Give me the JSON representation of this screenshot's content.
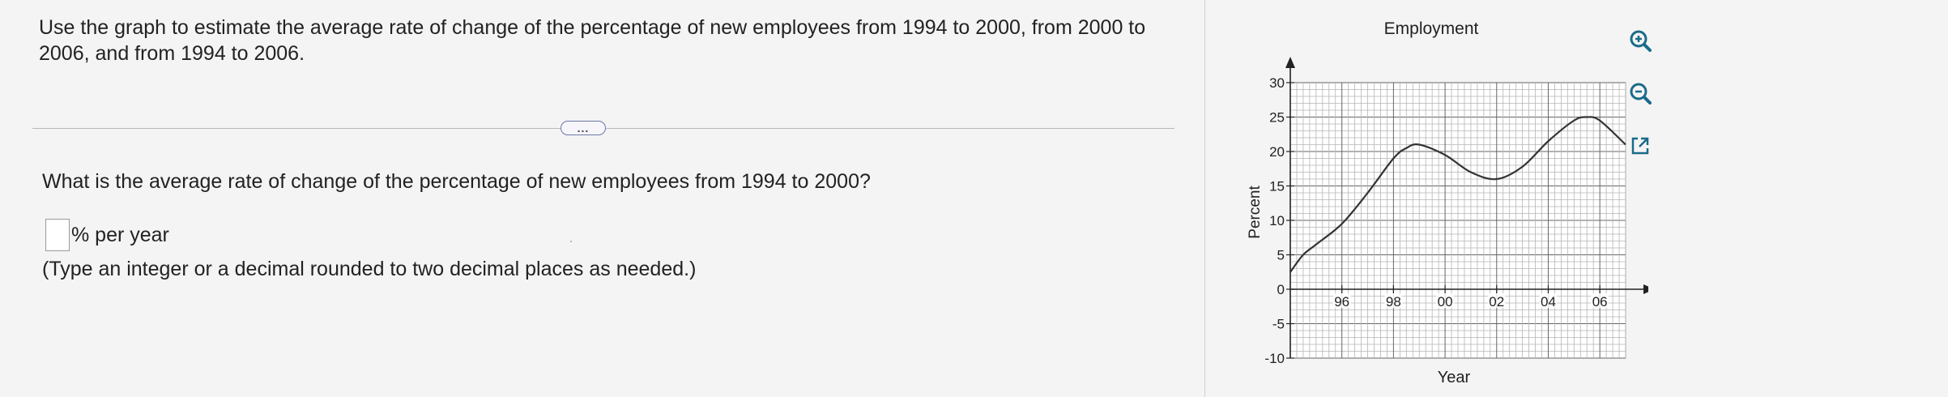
{
  "problem": {
    "prompt": "Use the graph to estimate the average rate of change of the percentage of new employees from 1994 to 2000, from 2000 to 2006, and from 1994 to 2006.",
    "more_label": "...",
    "question": "What is the average rate of change of the percentage of new employees from 1994 to 2000?",
    "answer": {
      "value": "",
      "unit": "% per year"
    },
    "hint": "(Type an integer or a decimal rounded to two decimal places as needed.)"
  },
  "graph": {
    "title": "Employment",
    "xlabel": "Year",
    "ylabel": "Percent",
    "y_ticks": [
      "30",
      "25",
      "20",
      "15",
      "10",
      "5",
      "0",
      "-5",
      "-10"
    ],
    "x_ticks": [
      "96",
      "98",
      "00",
      "02",
      "04",
      "06"
    ]
  },
  "chart_data": {
    "type": "line",
    "title": "Employment",
    "xlabel": "Year",
    "ylabel": "Percent",
    "xlim": [
      1994,
      2007
    ],
    "ylim": [
      -10,
      30
    ],
    "x_tick_values": [
      1996,
      1998,
      2000,
      2002,
      2004,
      2006
    ],
    "y_tick_values": [
      -10,
      -5,
      0,
      5,
      10,
      15,
      20,
      25,
      30
    ],
    "grid": true,
    "series": [
      {
        "x": [
          1994,
          1994.5,
          1995,
          1996,
          1997,
          1998,
          1998.5,
          1999,
          2000,
          2001,
          2002,
          2003,
          2004,
          2005,
          2005.5,
          2006,
          2007
        ],
        "y": [
          2.5,
          5,
          6.5,
          9.5,
          14,
          19,
          20.5,
          21,
          19.5,
          17,
          16,
          17.8,
          21.5,
          24.5,
          25,
          24.5,
          21
        ]
      }
    ]
  },
  "tools": {
    "icons": [
      "zoom-in-icon",
      "zoom-out-icon",
      "popout-icon"
    ],
    "color": "#1a6a8a"
  }
}
